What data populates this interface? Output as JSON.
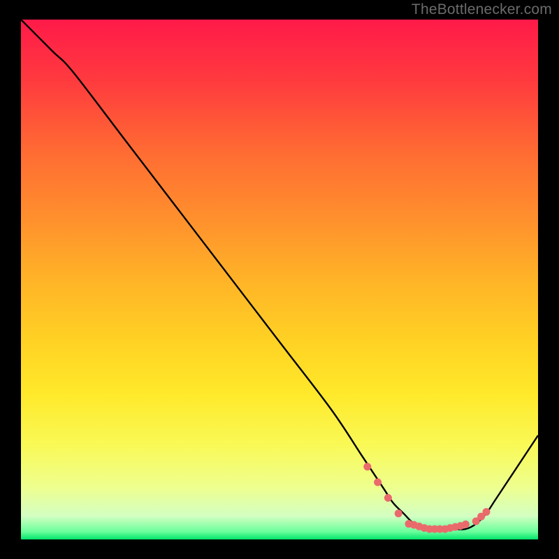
{
  "attribution": "TheBottlenecker.com",
  "colors": {
    "black": "#000000",
    "line": "#000000",
    "marker": "#ea6a6c",
    "gradient_stops": [
      {
        "offset": 0.0,
        "color": "#ff1a49"
      },
      {
        "offset": 0.12,
        "color": "#ff3b3e"
      },
      {
        "offset": 0.25,
        "color": "#ff6a33"
      },
      {
        "offset": 0.38,
        "color": "#ff8f2d"
      },
      {
        "offset": 0.5,
        "color": "#ffb327"
      },
      {
        "offset": 0.62,
        "color": "#ffd224"
      },
      {
        "offset": 0.72,
        "color": "#ffe92a"
      },
      {
        "offset": 0.82,
        "color": "#f9f957"
      },
      {
        "offset": 0.9,
        "color": "#eeff8f"
      },
      {
        "offset": 0.955,
        "color": "#d3ffc2"
      },
      {
        "offset": 0.985,
        "color": "#6bff9d"
      },
      {
        "offset": 1.0,
        "color": "#00e56b"
      }
    ]
  },
  "chart_data": {
    "type": "line",
    "title": "",
    "xlabel": "",
    "ylabel": "",
    "ylim": [
      0,
      100
    ],
    "xlim": [
      0,
      100
    ],
    "series": [
      {
        "name": "bottleneck-curve",
        "x": [
          0,
          6,
          10,
          20,
          30,
          40,
          50,
          60,
          66,
          70,
          72,
          74,
          76,
          78,
          80,
          82,
          84,
          86,
          88,
          90,
          92,
          100
        ],
        "y": [
          100,
          94,
          90,
          77,
          64,
          51,
          38,
          25,
          16,
          10,
          7,
          5,
          3,
          2,
          2,
          2,
          2,
          2,
          3,
          5,
          8,
          20
        ]
      }
    ],
    "markers": {
      "name": "highlight-dots",
      "x": [
        67,
        69,
        71,
        73,
        75,
        76,
        77,
        78,
        79,
        80,
        81,
        82,
        83,
        84,
        85,
        86,
        88,
        89,
        90
      ],
      "y": [
        14,
        11,
        8,
        5,
        3,
        2.8,
        2.5,
        2.2,
        2,
        2,
        2,
        2,
        2.2,
        2.4,
        2.6,
        2.9,
        3.5,
        4.4,
        5.3
      ]
    }
  }
}
